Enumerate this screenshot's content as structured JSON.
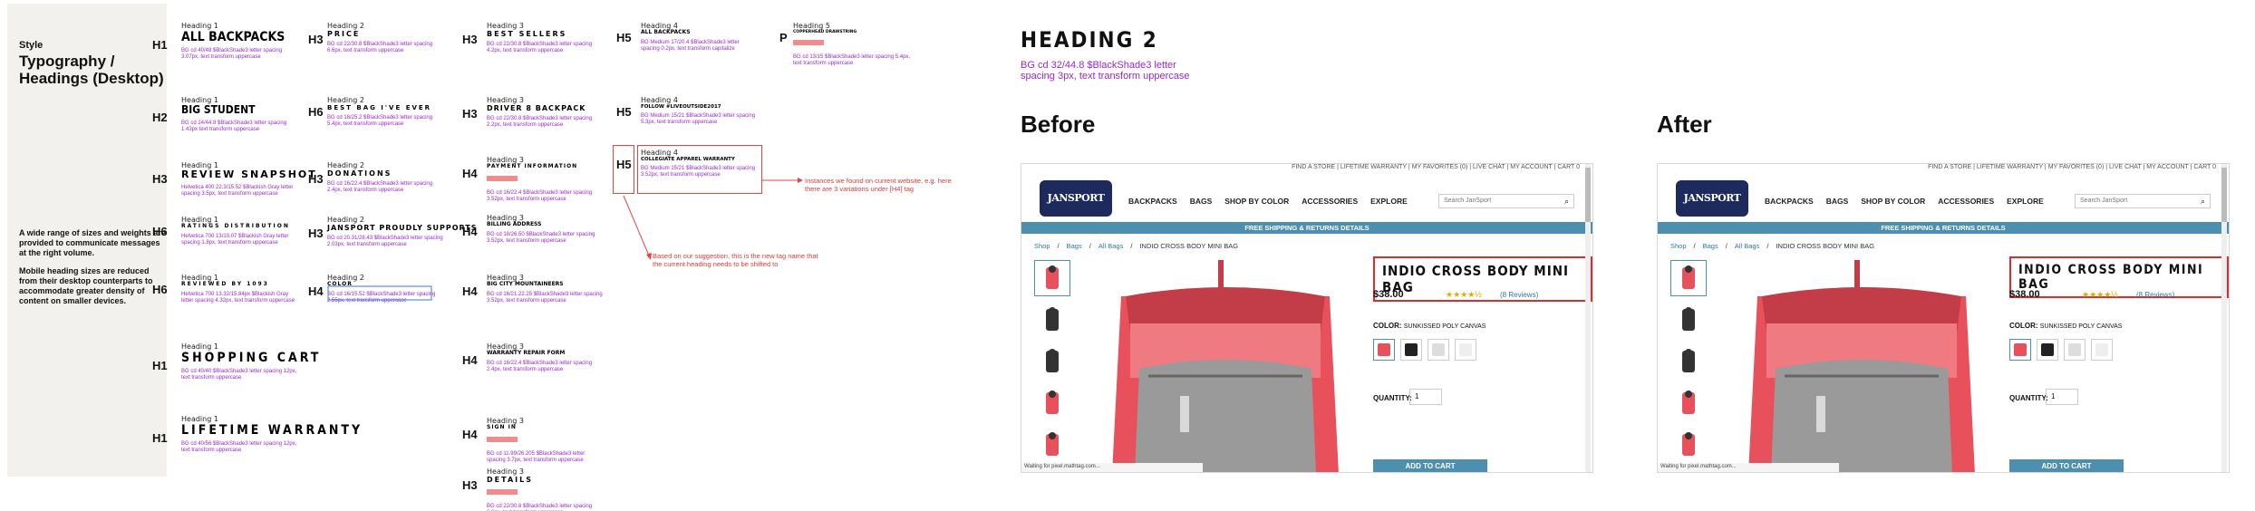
{
  "sidebar": {
    "style_label": "Style",
    "title": "Typography / Headings (Desktop)",
    "note1": "A wide range of sizes and weights are provided to communicate messages at the right volume.",
    "note2": "Mobile heading sizes are reduced from their desktop counterparts to accommodate greater density of content on smaller devices."
  },
  "columns": [
    {
      "items": [
        {
          "tag": "H1",
          "label": "Heading 1",
          "text": "All Backpacks",
          "size": 14,
          "ls": 0,
          "spec": "BG cd 40/48 $BlackShade3 letter spacing 3.07px, text transform uppercase"
        },
        {
          "tag": "H2",
          "label": "Heading 1",
          "text": "Big Student",
          "size": 12,
          "ls": 0,
          "spec": "BG cd 24/44.8 $BlackShade3 letter spacing 1.43px text transform uppercase"
        },
        {
          "tag": "H3",
          "label": "Heading 1",
          "text": "Review Snapshot",
          "size": 11,
          "ls": 2,
          "spec": "Helvetica 400 22.3/15.52 $Blackish Gray letter spacing 3.5px, text transform uppercase"
        },
        {
          "tag": "H6",
          "label": "Heading 1",
          "text": "Ratings Distribution",
          "size": 6,
          "ls": 2,
          "spec": "Helvetica 700 13/10.07 $Blackish Gray letter spacing 1.8px, text transform uppercase"
        },
        {
          "tag": "H6",
          "label": "Heading 1",
          "text": "Reviewed by 1093",
          "size": 6,
          "ls": 2,
          "spec": "Helvetica 700 13.32/15.84px $Blackish Gray letter spacing 4.32px, text transform uppercase"
        },
        {
          "tag": "H1",
          "label": "Heading 1",
          "text": "Shopping Cart",
          "size": 14,
          "ls": 3,
          "spec": "BG cd 40/40 $BlackShade3 letter spacing 12px, text transform uppercase"
        },
        {
          "tag": "H1",
          "label": "Heading 1",
          "text": "Lifetime Warranty",
          "size": 14,
          "ls": 3,
          "spec": "BG cd 40/56 $BlackShade3 letter spacing 12px, text transform uppercase"
        }
      ]
    },
    {
      "items": [
        {
          "tag": "H3",
          "label": "Heading 2",
          "text": "Price",
          "size": 8,
          "ls": 2,
          "spec": "BG cd 22/30.8 $BlackShade3 letter spacing 6.6px, text transform uppercase"
        },
        {
          "tag": "H6",
          "label": "Heading 2",
          "text": "Best bag I've ever",
          "size": 7,
          "ls": 2,
          "spec": "BG cd 18/25.2 $BlackShade3 letter spacing 5.4px, text transform uppercase"
        },
        {
          "tag": "H3",
          "label": "Heading 2",
          "text": "Donations",
          "size": 8,
          "ls": 2,
          "spec": "BG cd 16/22.4 $BlackShade3 letter spacing 2.4px, text transform uppercase"
        },
        {
          "tag": "H3",
          "label": "Heading 2",
          "text": "Jansport proudly supports",
          "size": 8,
          "ls": 1,
          "spec": "BG cd 20.31/28.43 $BlackShade3 letter spacing 2.03px, text transform uppercase"
        },
        {
          "tag": "H4",
          "label": "Heading 2",
          "text": "Color",
          "size": 6,
          "ls": 1,
          "spec": "BG cd 16/15.52 $BlackShade3 letter spacing 2.55px, text transform uppercase"
        }
      ]
    },
    {
      "items": [
        {
          "tag": "H3",
          "label": "Heading 3",
          "text": "Best Sellers",
          "size": 8,
          "ls": 2,
          "spec": "BG cd 22/30.8 $BlackShade3 letter spacing 4.2px, text transform uppercase"
        },
        {
          "tag": "H3",
          "label": "Heading 3",
          "text": "Driver 8 Backpack",
          "size": 8,
          "ls": 1,
          "spec": "BG cd 22/30.8 $BlackShade3 letter spacing 2.2px, text transform uppercase"
        },
        {
          "tag": "H4",
          "label": "Heading 3",
          "text": "Payment Information",
          "size": 6,
          "ls": 1,
          "spec": "BG cd 16/22.4 $BlackShade3 letter spacing 3.52px, text transform uppercase"
        },
        {
          "tag": "H4",
          "label": "Heading 3",
          "text": "Billing Address",
          "size": 6,
          "ls": 0,
          "spec": "BG cd 18/26.50 $BlackShade3 letter spacing 3.52px, text transform uppercase"
        },
        {
          "tag": "H4",
          "label": "Heading 3",
          "text": "Big City Mountaineers",
          "size": 6,
          "ls": 0,
          "spec": "BG cd 16/21.22.25 $BlackShade3 letter spacing 3.52px, text transform uppercase"
        },
        {
          "tag": "H4",
          "label": "Heading 3",
          "text": "Warranty Repair Form",
          "size": 6,
          "ls": 0,
          "spec": "BG cd 16/22.4 $BlackShade3 letter spacing 2.4px, text transform uppercase"
        },
        {
          "tag": "H4",
          "label": "Heading 3",
          "text": "Sign In",
          "size": 6,
          "ls": 1,
          "spec": "BG cd 11.99/26.205 $BlackShade3 letter spacing 3.7px, text transform uppercase"
        },
        {
          "tag": "H3",
          "label": "Heading 3",
          "text": "Details",
          "size": 8,
          "ls": 2,
          "spec": "BG cd 22/30.8 $BlackShade3 letter spacing 6.6px, text transform uppercase"
        }
      ]
    },
    {
      "items": [
        {
          "tag": "H5",
          "label": "Heading 4",
          "text": "All Backpacks",
          "size": 6,
          "ls": 0,
          "spec": "BG Medium 17/20.4 $BlackShade3 letter spacing 0.2px, text transform capitalize"
        },
        {
          "tag": "H5",
          "label": "Heading 4",
          "text": "Follow #LIVEOUTSIDE2017",
          "size": 5.5,
          "ls": 0,
          "spec": "BG Medium 15/21 $BlackShade3 letter spacing 5.3px, text transform uppercase"
        },
        {
          "tag": "H5",
          "label": "Heading 4",
          "text": "Collegiate Apparel Warranty",
          "size": 5.5,
          "ls": 0,
          "spec": "BG Medium 15/21 $BlackShade3 letter spacing 3.52px, text transform uppercase"
        }
      ]
    },
    {
      "items": [
        {
          "tag": "P",
          "label": "Heading 5",
          "text": "Copperhead Drawstring",
          "size": 4.5,
          "ls": 0,
          "spec": "BG cd 13/15 $BlackShade3 letter spacing 5.4px, text transform uppercase"
        }
      ]
    }
  ],
  "annotations": {
    "instances": "Instances we found on current website, e.g. here there are 3 variations under [H4] tag",
    "suggestion": "Based on our suggestion, this is the new tag name that the current heading needs to be shifted to"
  },
  "heading2": {
    "title": "Heading 2",
    "spec": "BG cd 32/44.8 $BlackShade3 letter spacing 3px, text transform uppercase"
  },
  "before_label": "Before",
  "after_label": "After",
  "page": {
    "topbar": "FIND A STORE  |  LIFETIME WARRANTY  |  MY FAVORITES (0)  |  LIVE CHAT  |  MY ACCOUNT  |  CART 0",
    "logo": "JANSPORT",
    "menu": [
      "BACKPACKS",
      "BAGS",
      "SHOP BY COLOR",
      "ACCESSORIES",
      "EXPLORE"
    ],
    "search_placeholder": "Search JanSport",
    "ship_banner": "FREE SHIPPING & RETURNS DETAILS",
    "crumbs": [
      "Shop",
      "/",
      "Bags",
      "/",
      "All Bags",
      "/",
      "INDIO CROSS BODY MINI BAG"
    ],
    "product_title": "INDIO CROSS BODY MINI BAG",
    "price": "$38.00",
    "stars": "★★★★½",
    "reviews": "(8 Reviews)",
    "color_label": "COLOR:",
    "color_value": "SUNKISSED POLY CANVAS",
    "qty_label": "QUANTITY:",
    "qty_value": "1",
    "cart_button": "ADD TO CART",
    "status": "Waiting for pixel.mathtag.com..."
  },
  "colors": {
    "spec_purple": "#9b27d6",
    "accent_red": "#e02b2b",
    "brand_blue": "#4d8fae",
    "bag_red": "#e8505b"
  }
}
